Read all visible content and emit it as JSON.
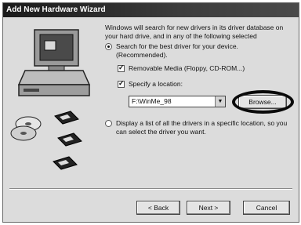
{
  "window": {
    "title": "Add New Hardware Wizard"
  },
  "description": "Windows will search for new drivers in its driver database on your hard drive, and in any of the following selected",
  "options": {
    "search_best": {
      "label": "Search for the best driver for your device. (Recommended).",
      "selected": true
    },
    "removable_media": {
      "label": "Removable Media (Floppy, CD-ROM...)",
      "checked": true
    },
    "specify_location": {
      "label": "Specify a location:",
      "checked": true
    },
    "display_list": {
      "label": "Display a list of all the drivers in a specific location, so you can select the driver you want.",
      "selected": false
    }
  },
  "location_value": "F:\\WinMe_98",
  "buttons": {
    "browse": "Browse...",
    "back": "< Back",
    "next": "Next >",
    "cancel": "Cancel"
  },
  "icons": {
    "dropdown": "chevron-down-icon",
    "hardware": "computer-and-disks-icon"
  }
}
